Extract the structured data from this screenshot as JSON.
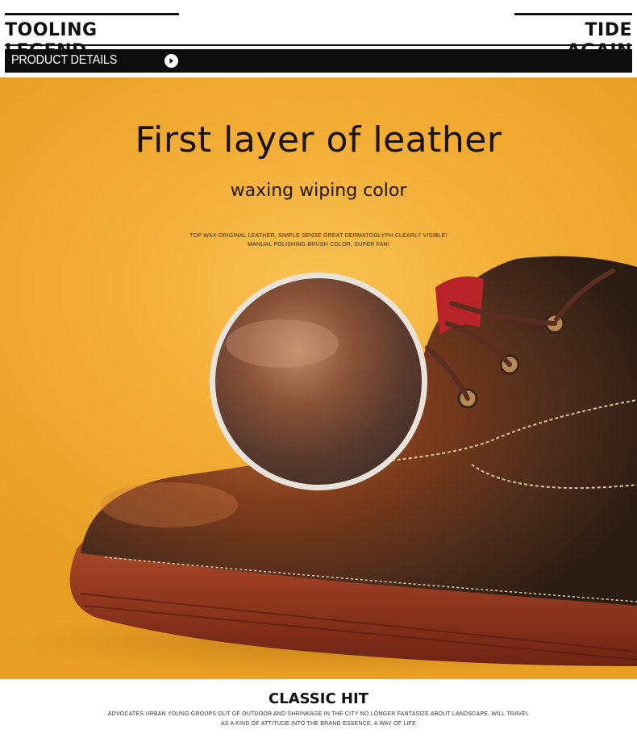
{
  "header": {
    "brand_left": "TOOLING LEGEND",
    "brand_right": "TIDE AGAIN",
    "section_label": "PRODUCT DETAILS",
    "section_icon": "play-arrow-icon"
  },
  "hero": {
    "title": "First layer of leather",
    "subtitle": "waxing wiping color",
    "description_line1": "TOP WAX ORIGINAL LEATHER, SIMPLE SENSE GREAT DERMATOGLYPH CLEARLY VISIBLE!",
    "description_line2": "MANUAL POLISHING BRUSH COLOR, SUPER FAN!",
    "background_color": "#f3ae37",
    "leather_color": "#7a3a1c"
  },
  "footer": {
    "title": "CLASSIC HIT",
    "description_line1": "ADVOCATES URBAN YOUNG GROUPS OUT OF OUTDOOR AND SHRINKAGE IN THE CITY NO LONGER FANTASIZE ABOUT LANDSCAPE, WILL TRAVEL",
    "description_line2": "AS A KIND OF ATTITUDE INTO THE BRAND ESSENCE, A WAY OF LIFE"
  }
}
